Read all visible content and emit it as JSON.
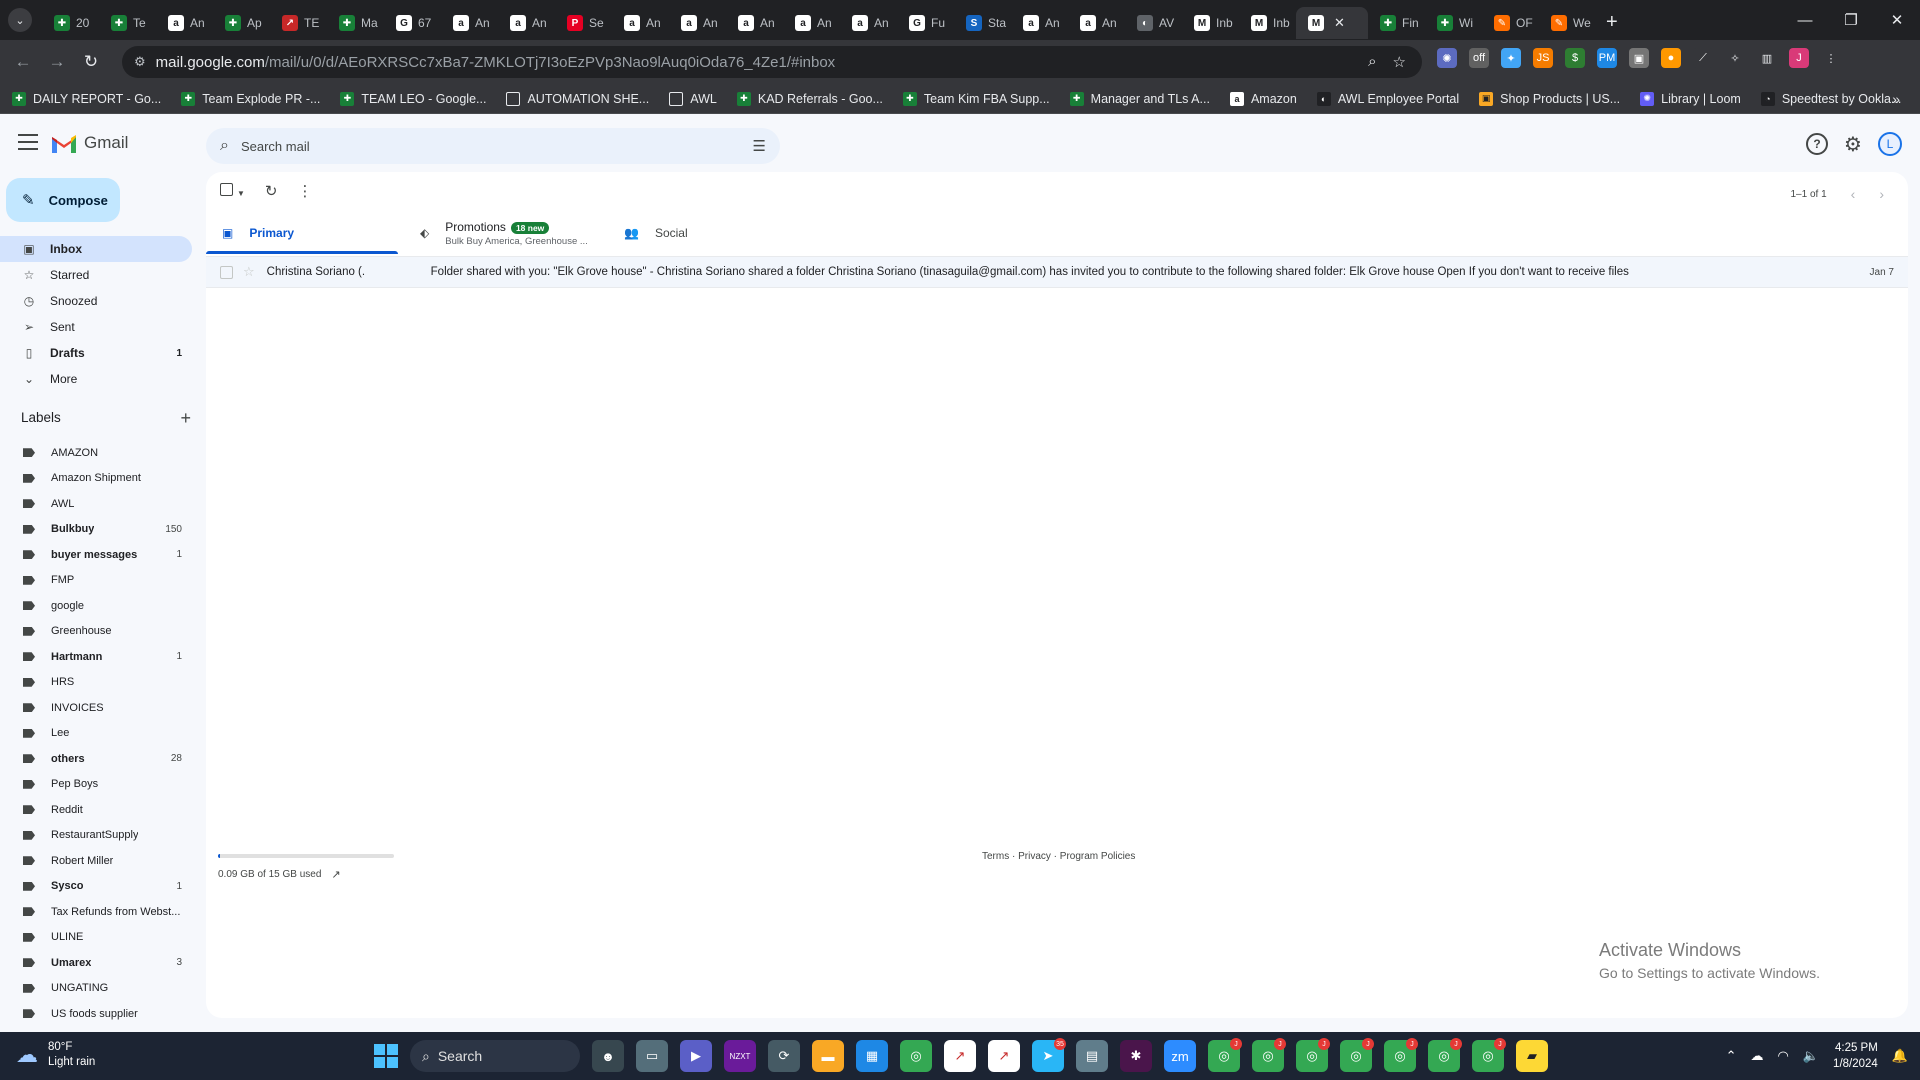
{
  "browser": {
    "tabs": [
      {
        "title": "20",
        "icon": "sheets",
        "color": "#188038"
      },
      {
        "title": "Te",
        "icon": "sheets",
        "color": "#188038"
      },
      {
        "title": "An",
        "icon": "amazon",
        "color": "#ffffff"
      },
      {
        "title": "Ap",
        "icon": "sheets",
        "color": "#188038"
      },
      {
        "title": "TE",
        "icon": "chart",
        "color": "#c62828"
      },
      {
        "title": "Ma",
        "icon": "sheets",
        "color": "#188038"
      },
      {
        "title": "67",
        "icon": "google",
        "color": "#ffffff"
      },
      {
        "title": "An",
        "icon": "amazon",
        "color": "#ffffff"
      },
      {
        "title": "An",
        "icon": "amazon",
        "color": "#ffffff"
      },
      {
        "title": "Se",
        "icon": "pinterest",
        "color": "#e60023"
      },
      {
        "title": "An",
        "icon": "amazon",
        "color": "#ffffff"
      },
      {
        "title": "An",
        "icon": "amazon",
        "color": "#ffffff"
      },
      {
        "title": "An",
        "icon": "amazon",
        "color": "#ffffff"
      },
      {
        "title": "An",
        "icon": "amazon",
        "color": "#ffffff"
      },
      {
        "title": "An",
        "icon": "amazon",
        "color": "#ffffff"
      },
      {
        "title": "Fu",
        "icon": "google",
        "color": "#ffffff"
      },
      {
        "title": "Sta",
        "icon": "stats",
        "color": "#1565c0"
      },
      {
        "title": "An",
        "icon": "amazon",
        "color": "#ffffff"
      },
      {
        "title": "An",
        "icon": "amazon",
        "color": "#ffffff"
      },
      {
        "title": "AV",
        "icon": "globe",
        "color": "#5f6368"
      },
      {
        "title": "Inb",
        "icon": "gmail",
        "color": "#ffffff"
      },
      {
        "title": "Inb",
        "icon": "gmail",
        "color": "#ffffff"
      },
      {
        "title": "",
        "icon": "gmail",
        "color": "#ffffff",
        "active": true
      },
      {
        "title": "Fin",
        "icon": "sheets",
        "color": "#188038"
      },
      {
        "title": "Wi",
        "icon": "sheets",
        "color": "#188038"
      },
      {
        "title": "OF",
        "icon": "pen",
        "color": "#ff6d00"
      },
      {
        "title": "We",
        "icon": "pen",
        "color": "#ff6d00"
      }
    ],
    "url_host": "mail.google.com",
    "url_path": "/mail/u/0/d/AEoRXRSCc7xBa7-ZMKLOTj7I3oEzPVp3Nao9lAuq0iOda76_4Ze1/#inbox",
    "profile_initial": "J",
    "extensions": [
      {
        "name": "puzzle-ext",
        "color": "#5c6bc0",
        "label": "✺"
      },
      {
        "name": "off-ext",
        "color": "#616161",
        "label": "off"
      },
      {
        "name": "gear-ext",
        "color": "#42a5f5",
        "label": "✦"
      },
      {
        "name": "js-ext",
        "color": "#f57c00",
        "label": "JS"
      },
      {
        "name": "s-ext",
        "color": "#2e7d32",
        "label": "$"
      },
      {
        "name": "pm-ext",
        "color": "#1e88e5",
        "label": "PM"
      },
      {
        "name": "box-ext",
        "color": "#757575",
        "label": "▣"
      },
      {
        "name": "circle-ext",
        "color": "#ff9800",
        "label": "●"
      },
      {
        "name": "line-ext",
        "color": "#35363a",
        "label": "⟋"
      }
    ],
    "bookmarks": [
      {
        "label": "DAILY REPORT - Go...",
        "icon": "sheets",
        "color": "#188038"
      },
      {
        "label": "Team Explode PR -...",
        "icon": "sheets",
        "color": "#188038"
      },
      {
        "label": "TEAM LEO - Google...",
        "icon": "sheets",
        "color": "#188038"
      },
      {
        "label": "AUTOMATION SHE...",
        "icon": "folder",
        "color": "#35363a"
      },
      {
        "label": "AWL",
        "icon": "folder",
        "color": "#35363a"
      },
      {
        "label": "KAD Referrals - Goo...",
        "icon": "sheets",
        "color": "#188038"
      },
      {
        "label": "Team Kim FBA Supp...",
        "icon": "sheets",
        "color": "#188038"
      },
      {
        "label": "Manager and TLs A...",
        "icon": "sheets",
        "color": "#188038"
      },
      {
        "label": "Amazon",
        "icon": "amazon",
        "color": "#ffffff"
      },
      {
        "label": "AWL Employee Portal",
        "icon": "globe",
        "color": "#202124"
      },
      {
        "label": "Shop Products | US...",
        "icon": "shop",
        "color": "#f9a825"
      },
      {
        "label": "Library | Loom",
        "icon": "loom",
        "color": "#625df5"
      },
      {
        "label": "Speedtest by Ookla...",
        "icon": "speedtest",
        "color": "#202124"
      }
    ]
  },
  "gmail": {
    "app_name": "Gmail",
    "search_placeholder": "Search mail",
    "compose_label": "Compose",
    "nav": [
      {
        "label": "Inbox",
        "icon": "inbox",
        "count": "",
        "active": true
      },
      {
        "label": "Starred",
        "icon": "star",
        "count": ""
      },
      {
        "label": "Snoozed",
        "icon": "clock",
        "count": ""
      },
      {
        "label": "Sent",
        "icon": "send",
        "count": ""
      },
      {
        "label": "Drafts",
        "icon": "draft",
        "count": "1",
        "bold": true
      },
      {
        "label": "More",
        "icon": "chevron-down",
        "count": ""
      }
    ],
    "labels_heading": "Labels",
    "labels": [
      {
        "label": "AMAZON",
        "count": ""
      },
      {
        "label": "Amazon Shipment",
        "count": ""
      },
      {
        "label": "AWL",
        "count": ""
      },
      {
        "label": "Bulkbuy",
        "count": "150",
        "bold": true
      },
      {
        "label": "buyer messages",
        "count": "1",
        "bold": true
      },
      {
        "label": "FMP",
        "count": ""
      },
      {
        "label": "google",
        "count": ""
      },
      {
        "label": "Greenhouse",
        "count": ""
      },
      {
        "label": "Hartmann",
        "count": "1",
        "bold": true
      },
      {
        "label": "HRS",
        "count": ""
      },
      {
        "label": "INVOICES",
        "count": ""
      },
      {
        "label": "Lee",
        "count": ""
      },
      {
        "label": "others",
        "count": "28",
        "bold": true
      },
      {
        "label": "Pep Boys",
        "count": ""
      },
      {
        "label": "Reddit",
        "count": ""
      },
      {
        "label": "RestaurantSupply",
        "count": ""
      },
      {
        "label": "Robert Miller",
        "count": ""
      },
      {
        "label": "Sysco",
        "count": "1",
        "bold": true
      },
      {
        "label": "Tax Refunds from Webst...",
        "count": ""
      },
      {
        "label": "ULINE",
        "count": ""
      },
      {
        "label": "Umarex",
        "count": "3",
        "bold": true
      },
      {
        "label": "UNGATING",
        "count": ""
      },
      {
        "label": "US foods supplier",
        "count": ""
      }
    ],
    "pager_text": "1–1 of 1",
    "categories": {
      "primary": "Primary",
      "promotions": "Promotions",
      "promotions_badge": "18 new",
      "promotions_sub": "Bulk Buy America, Greenhouse ...",
      "social": "Social"
    },
    "emails": [
      {
        "sender": "Christina Soriano (.",
        "subject_snippet": "Folder shared with you: \"Elk Grove house\" - Christina Soriano shared a folder Christina Soriano (tinasaguila@gmail.com) has invited you to contribute to the following shared folder: Elk Grove house Open If you don't want to receive files",
        "date": "Jan 7"
      }
    ],
    "storage_text": "0.09 GB of 15 GB used",
    "storage_fraction": 0.006,
    "footer_links": "Terms · Privacy · Program Policies",
    "watermark_title": "Activate Windows",
    "watermark_sub": "Go to Settings to activate Windows."
  },
  "taskbar": {
    "weather_temp": "80°F",
    "weather_desc": "Light rain",
    "search_label": "Search",
    "apps": [
      {
        "name": "hero-app",
        "color": "#37474f",
        "label": "☻",
        "badge": ""
      },
      {
        "name": "desktop-app",
        "color": "#546e7a",
        "label": "▭",
        "badge": ""
      },
      {
        "name": "teams-app",
        "color": "#5b5fc7",
        "label": "▶",
        "badge": ""
      },
      {
        "name": "nzxt-app",
        "color": "#6a1b9a",
        "label": "NZXT",
        "badge": ""
      },
      {
        "name": "edge-app",
        "color": "#455a64",
        "label": "⟳",
        "badge": ""
      },
      {
        "name": "explorer-app",
        "color": "#f9a825",
        "label": "▬",
        "badge": ""
      },
      {
        "name": "calendar-app",
        "color": "#1e88e5",
        "label": "▦",
        "badge": ""
      },
      {
        "name": "chrome-app-1",
        "color": "#34a853",
        "label": "◎",
        "badge": ""
      },
      {
        "name": "chart-app-1",
        "color": "#ffffff",
        "label": "↗",
        "badge": ""
      },
      {
        "name": "chart-app-2",
        "color": "#ffffff",
        "label": "↗",
        "badge": ""
      },
      {
        "name": "telegram-app",
        "color": "#29b6f6",
        "label": "➤",
        "badge": "35"
      },
      {
        "name": "calculator-app",
        "color": "#607d8b",
        "label": "▤",
        "badge": ""
      },
      {
        "name": "slack-app",
        "color": "#4a154b",
        "label": "✱",
        "badge": ""
      },
      {
        "name": "zoom-app",
        "color": "#2d8cff",
        "label": "zm",
        "badge": ""
      },
      {
        "name": "chrome-app-2",
        "color": "#34a853",
        "label": "◎",
        "badge": "J"
      },
      {
        "name": "chrome-app-3",
        "color": "#34a853",
        "label": "◎",
        "badge": "J"
      },
      {
        "name": "chrome-app-4",
        "color": "#34a853",
        "label": "◎",
        "badge": "J"
      },
      {
        "name": "chrome-app-5",
        "color": "#34a853",
        "label": "◎",
        "badge": "J"
      },
      {
        "name": "chrome-app-6",
        "color": "#34a853",
        "label": "◎",
        "badge": "J"
      },
      {
        "name": "chrome-app-7",
        "color": "#34a853",
        "label": "◎",
        "badge": "J"
      },
      {
        "name": "chrome-app-8",
        "color": "#34a853",
        "label": "◎",
        "badge": "J"
      },
      {
        "name": "sticky-notes-app",
        "color": "#fdd835",
        "label": "▰",
        "badge": ""
      }
    ],
    "time": "4:25 PM",
    "date": "1/8/2024"
  }
}
